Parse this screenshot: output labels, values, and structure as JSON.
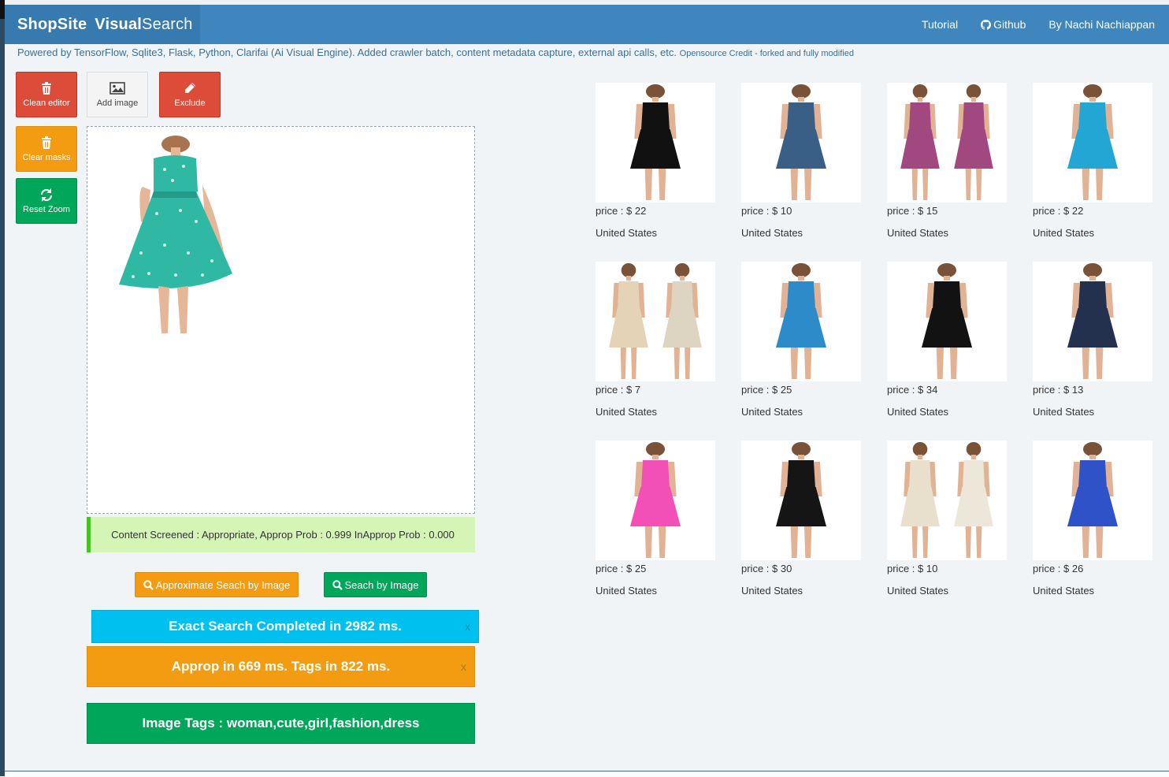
{
  "navbar": {
    "brand_bold": "ShopSite",
    "brand_strong": "Visual",
    "brand_light": "Search",
    "links": [
      {
        "label": "Tutorial",
        "icon": ""
      },
      {
        "label": "Github",
        "icon": "github-icon"
      },
      {
        "label": "By Nachi Nachiappan",
        "icon": ""
      }
    ],
    "color": "#3e86bd"
  },
  "powered": {
    "text": "Powered by TensorFlow, Sqlite3, Flask, Python, Clarifai (Ai Visual Engine). Added crawler batch, content metadata capture, external api calls, etc.",
    "credit": "Opensource Credit - forked and fully modified"
  },
  "tools": {
    "clean_editor": {
      "label": "Clean editor",
      "icon": "trash-icon"
    },
    "add_image": {
      "label": "Add image",
      "icon": "image-icon"
    },
    "exclude": {
      "label": "Exclude",
      "icon": "pencil-icon"
    },
    "clear_masks": {
      "label": "Clear masks",
      "icon": "trash-icon"
    },
    "reset_zoom": {
      "label": "Reset Zoom",
      "icon": "refresh-icon"
    }
  },
  "editor": {
    "image_desc": "teal floral skater dress",
    "dress_color": "#2fb9a4"
  },
  "screening": {
    "text": "Content Screened : Appropriate, Approp Prob : 0.999 InApprop Prob : 0.000"
  },
  "buttons": {
    "approx_search": "Approximate Seach by Image",
    "search": "Seach by Image"
  },
  "alerts": {
    "exact": "Exact Search Completed in 2982 ms.",
    "approp": "Approp in 669 ms. Tags in 822 ms.",
    "tags": "Image Tags : woman,cute,girl,fashion,dress",
    "close": "x"
  },
  "results": [
    {
      "price": "price : $ 22",
      "country": "United States",
      "colors": [
        "#111111"
      ]
    },
    {
      "price": "price : $ 10",
      "country": "United States",
      "colors": [
        "#3a5f86"
      ]
    },
    {
      "price": "price : $ 15",
      "country": "United States",
      "colors": [
        "#a0487f",
        "#a0487f"
      ]
    },
    {
      "price": "price : $ 22",
      "country": "United States",
      "colors": [
        "#23a6d3"
      ]
    },
    {
      "price": "price : $ 7",
      "country": "United States",
      "colors": [
        "#e4d3b6",
        "#ddd4c2"
      ]
    },
    {
      "price": "price : $ 25",
      "country": "United States",
      "colors": [
        "#2d8bc9"
      ]
    },
    {
      "price": "price : $ 34",
      "country": "United States",
      "colors": [
        "#121212"
      ]
    },
    {
      "price": "price : $ 13",
      "country": "United States",
      "colors": [
        "#23304e"
      ]
    },
    {
      "price": "price : $ 25",
      "country": "United States",
      "colors": [
        "#f24fb7"
      ]
    },
    {
      "price": "price : $ 30",
      "country": "United States",
      "colors": [
        "#151515"
      ]
    },
    {
      "price": "price : $ 10",
      "country": "United States",
      "colors": [
        "#e8e0cc",
        "#ede7d9"
      ]
    },
    {
      "price": "price : $ 26",
      "country": "United States",
      "colors": [
        "#2f52c8"
      ]
    }
  ]
}
